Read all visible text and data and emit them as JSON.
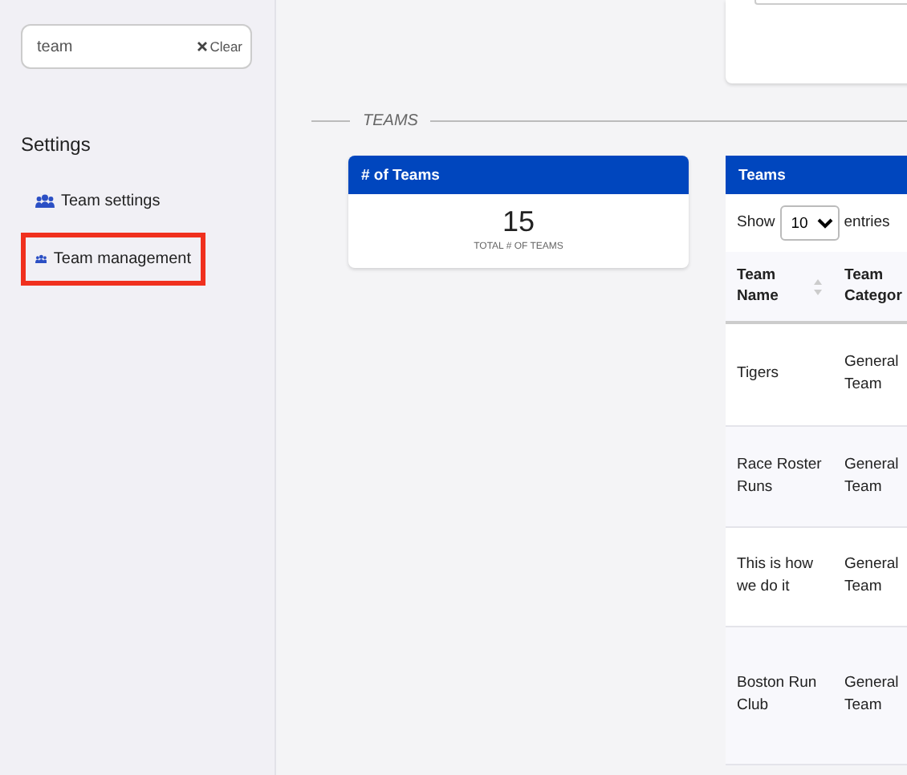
{
  "search": {
    "value": "team",
    "clear_label": "Clear"
  },
  "sidebar": {
    "heading": "Settings",
    "items": [
      {
        "label": "Team settings",
        "selected": false
      },
      {
        "label": "Team management",
        "selected": true
      }
    ]
  },
  "section_title": "TEAMS",
  "count_card": {
    "title": "# of Teams",
    "value": "15",
    "caption": "TOTAL # OF TEAMS"
  },
  "teams_card": {
    "title": "Teams",
    "show_label": "Show",
    "page_size": "10",
    "entries_label": "entries",
    "columns": [
      "Team Name",
      "Team Categor"
    ],
    "rows": [
      {
        "cells": [
          "Tigers",
          "General Team"
        ]
      },
      {
        "cells": [
          "Race Roster Runs",
          "General Team"
        ]
      },
      {
        "cells": [
          "This is how we do it",
          "General Team"
        ]
      },
      {
        "cells": [
          "Boston Run Club",
          "General Team"
        ]
      }
    ]
  }
}
